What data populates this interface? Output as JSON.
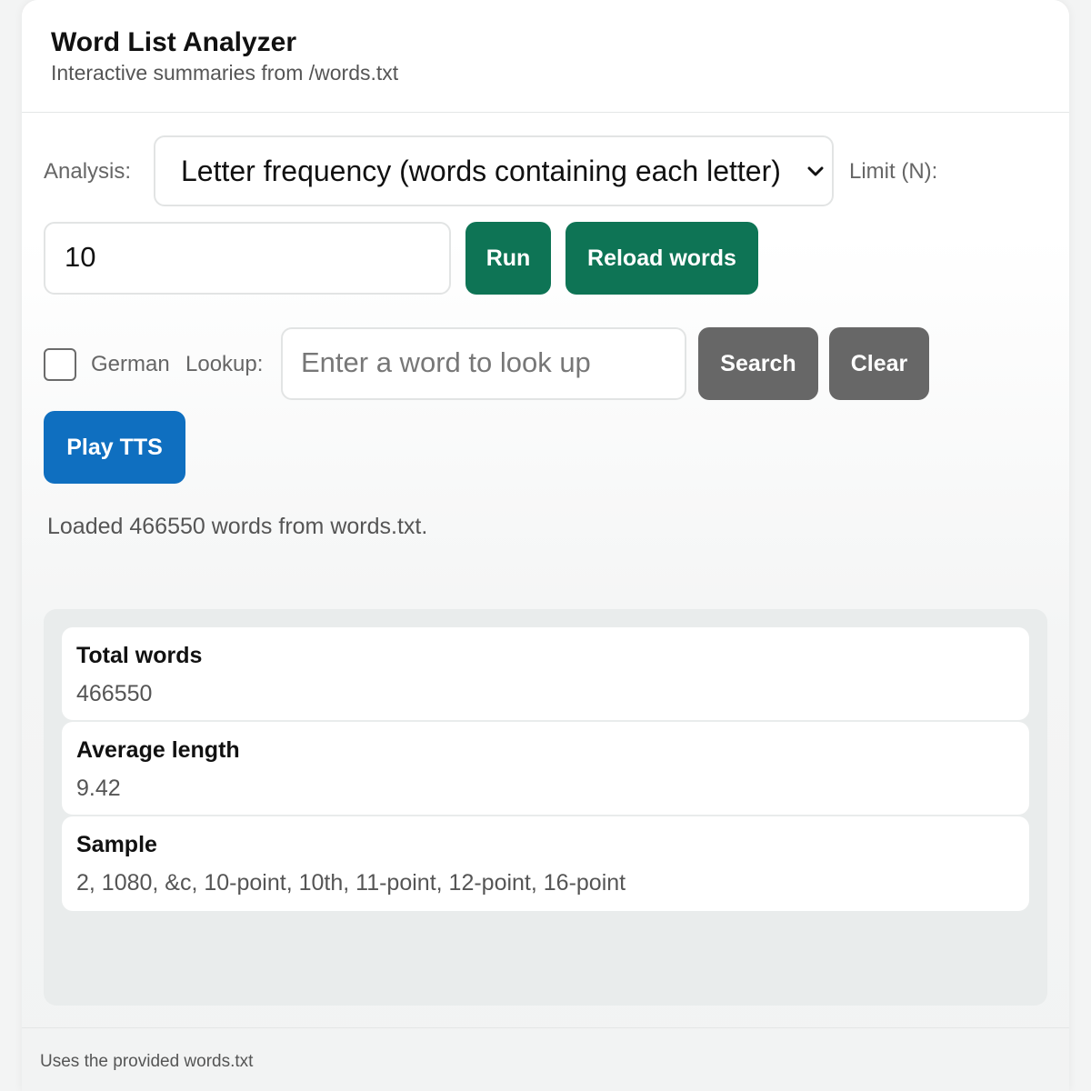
{
  "header": {
    "title": "Word List Analyzer",
    "subtitle": "Interactive summaries from /words.txt"
  },
  "controls": {
    "analysis_label": "Analysis:",
    "analysis_selected": "Letter frequency (words containing each letter)",
    "limit_label": "Limit (N):",
    "limit_value": "10",
    "run_label": "Run",
    "reload_label": "Reload words",
    "german_label": "German",
    "german_checked": false,
    "lookup_label": "Lookup:",
    "lookup_placeholder": "Enter a word to look up",
    "search_label": "Search",
    "clear_label": "Clear",
    "tts_label": "Play TTS"
  },
  "status": "Loaded 466550 words from words.txt.",
  "results": [
    {
      "title": "Total words",
      "value": "466550"
    },
    {
      "title": "Average length",
      "value": "9.42"
    },
    {
      "title": "Sample",
      "value": "2, 1080, &c, 10-point, 10th, 11-point, 12-point, 16-point"
    }
  ],
  "footer": "Uses the provided words.txt",
  "colors": {
    "primary_green": "#0e7455",
    "neutral_gray": "#676767",
    "tts_blue": "#0f6fc0"
  }
}
